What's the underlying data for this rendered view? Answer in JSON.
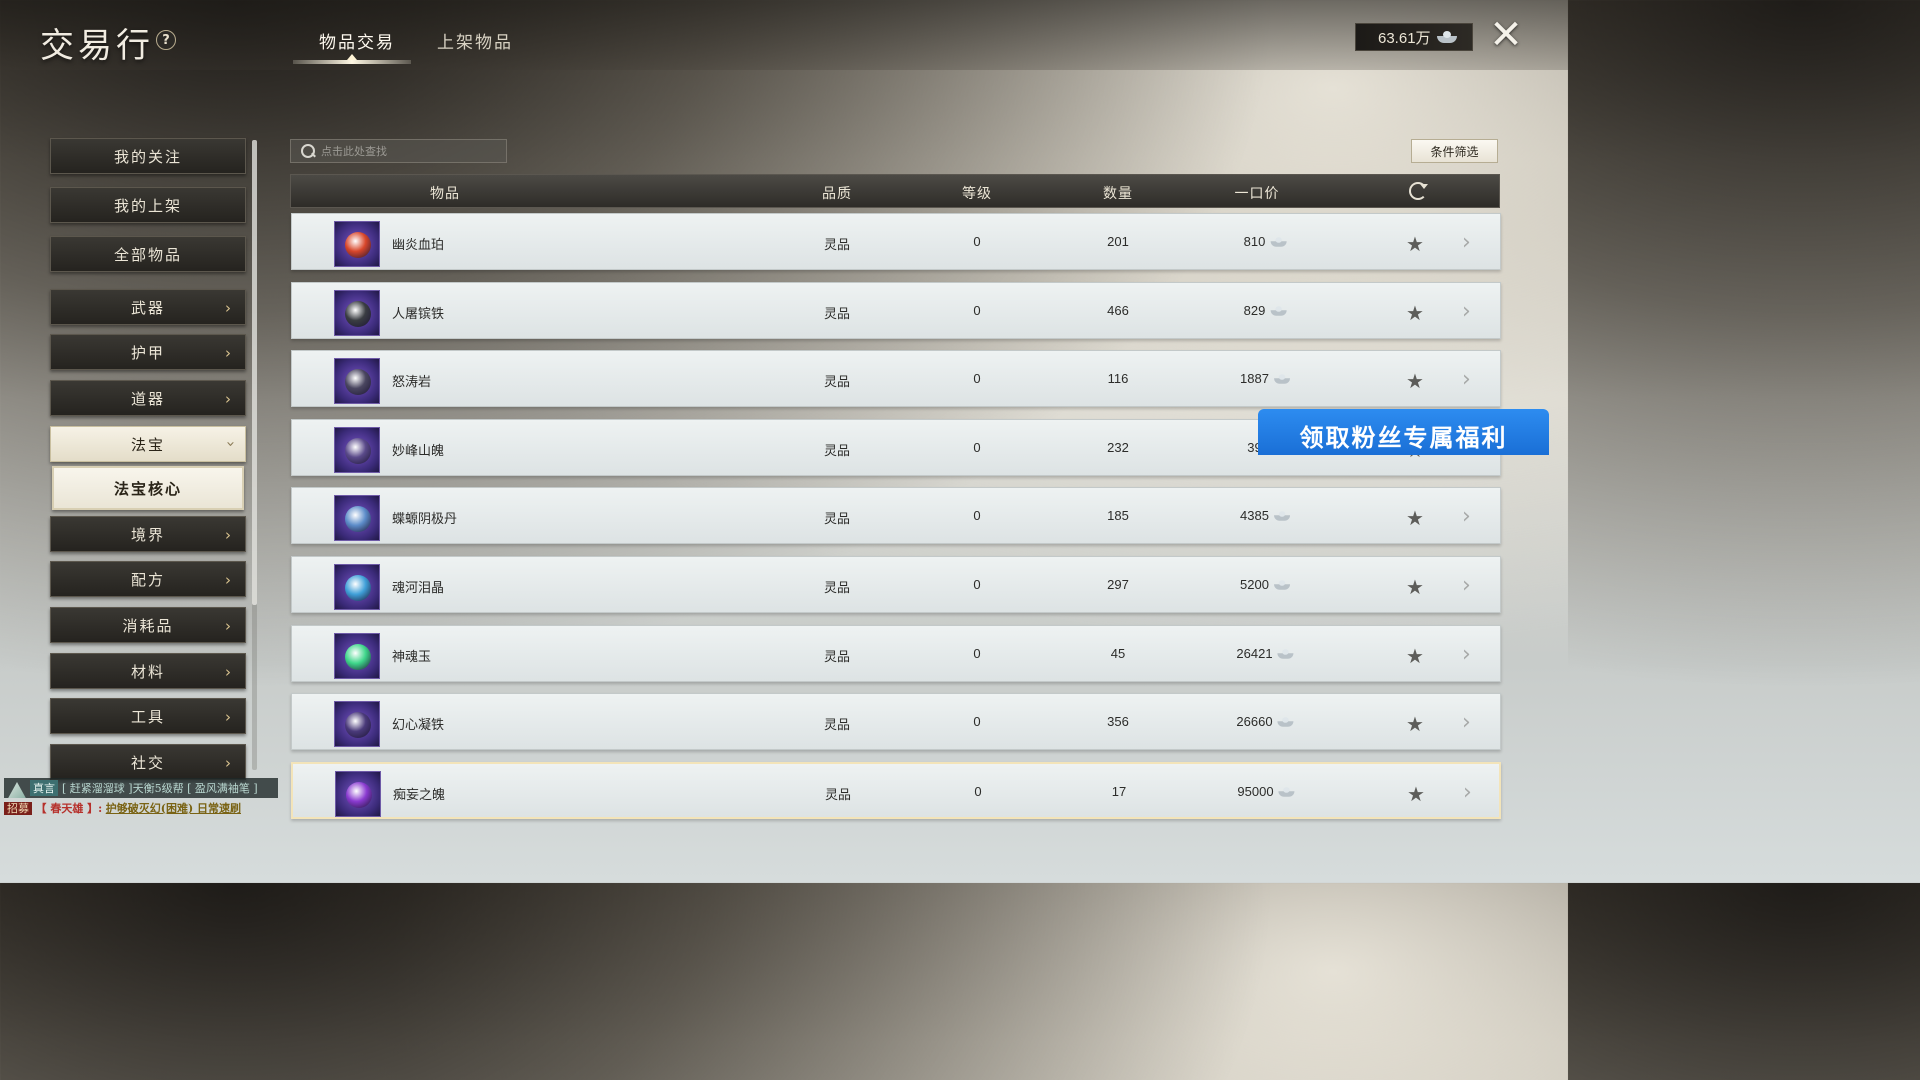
{
  "header": {
    "title": "交易行",
    "help": "?",
    "tabs": [
      {
        "label": "物品交易",
        "active": true
      },
      {
        "label": "上架物品",
        "active": false
      }
    ],
    "currency": {
      "amount": "63.61万",
      "icon": "silver-ingot-icon"
    },
    "close": "✕"
  },
  "sidebar": {
    "items": [
      {
        "label": "我的关注",
        "arrow": false
      },
      {
        "label": "我的上架",
        "arrow": false
      },
      {
        "label": "全部物品",
        "arrow": false
      },
      {
        "label": "武器",
        "arrow": true
      },
      {
        "label": "护甲",
        "arrow": true
      },
      {
        "label": "道器",
        "arrow": true
      },
      {
        "label": "法宝",
        "arrow": true,
        "active": true
      },
      {
        "label": "法宝核心",
        "sub": true
      },
      {
        "label": "境界",
        "arrow": true
      },
      {
        "label": "配方",
        "arrow": true
      },
      {
        "label": "消耗品",
        "arrow": true
      },
      {
        "label": "材料",
        "arrow": true
      },
      {
        "label": "工具",
        "arrow": true
      },
      {
        "label": "社交",
        "arrow": true
      }
    ]
  },
  "search": {
    "placeholder": "点击此处查找"
  },
  "filter_label": "条件筛选",
  "table": {
    "columns": [
      "物品",
      "品质",
      "等级",
      "数量",
      "一口价"
    ],
    "rows": [
      {
        "name": "幽炎血珀",
        "quality": "灵品",
        "level": "0",
        "quantity": "201",
        "price": "810",
        "gem": "#d8462a"
      },
      {
        "name": "人屠镔铁",
        "quality": "灵品",
        "level": "0",
        "quantity": "466",
        "price": "829",
        "gem": "#3a3d42"
      },
      {
        "name": "怒涛岩",
        "quality": "灵品",
        "level": "0",
        "quantity": "116",
        "price": "1887",
        "gem": "#4a4660"
      },
      {
        "name": "妙峰山魄",
        "quality": "灵品",
        "level": "0",
        "quantity": "232",
        "price": "39",
        "gem": "#5a4a8a"
      },
      {
        "name": "蝶螈阴极丹",
        "quality": "灵品",
        "level": "0",
        "quantity": "185",
        "price": "4385",
        "gem": "#5c8cc9"
      },
      {
        "name": "魂河泪晶",
        "quality": "灵品",
        "level": "0",
        "quantity": "297",
        "price": "5200",
        "gem": "#3f9fd8"
      },
      {
        "name": "神魂玉",
        "quality": "灵品",
        "level": "0",
        "quantity": "45",
        "price": "26421",
        "gem": "#3ed68a"
      },
      {
        "name": "幻心凝铁",
        "quality": "灵品",
        "level": "0",
        "quantity": "356",
        "price": "26660",
        "gem": "#4a3a7a"
      },
      {
        "name": "痴妄之魄",
        "quality": "灵品",
        "level": "0",
        "quantity": "17",
        "price": "95000",
        "gem": "#8a3ad0"
      }
    ]
  },
  "promo": "领取粉丝专属福利",
  "chat": {
    "line1_tag": "真言",
    "line1_text": "[ 赶紧溜溜球 ]天衡5级帮 [ 盈风满袖笔  ]",
    "line2_tag": "招募",
    "line2_sender": "【 春天雄 】:",
    "line2_msg": "护够破灭幻(困难) 日常速刷"
  }
}
